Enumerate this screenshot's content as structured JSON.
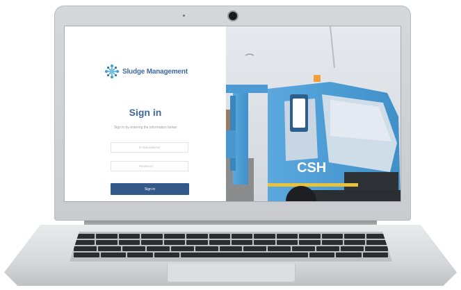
{
  "app": {
    "brand_name": "Sludge Management",
    "brand_color": "#3f6aa2"
  },
  "login": {
    "title": "Sign in",
    "subtitle": "Sign in by entering the information below",
    "email_placeholder": "E-mail address",
    "password_placeholder": "Password",
    "submit_label": "Sign in",
    "button_color": "#33598a"
  },
  "hero_image": {
    "truck_logo": "CSH",
    "truck_color": "#4f9ed6"
  }
}
